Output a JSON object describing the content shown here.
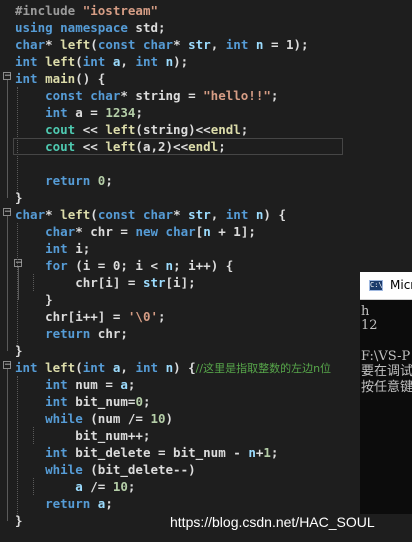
{
  "editor": {
    "lines": [
      [
        {
          "t": "#include ",
          "c": "pp"
        },
        {
          "t": "\"iostream\"",
          "c": "str"
        }
      ],
      [
        {
          "t": "using namespace ",
          "c": "kw"
        },
        {
          "t": "std;",
          "c": "var"
        }
      ],
      [
        {
          "t": "char",
          "c": "kw"
        },
        {
          "t": "* ",
          "c": "var"
        },
        {
          "t": "left",
          "c": "fn"
        },
        {
          "t": "(",
          "c": "var"
        },
        {
          "t": "const char",
          "c": "kw"
        },
        {
          "t": "* ",
          "c": "var"
        },
        {
          "t": "str",
          "c": "pm"
        },
        {
          "t": ", ",
          "c": "var"
        },
        {
          "t": "int ",
          "c": "kw"
        },
        {
          "t": "n",
          "c": "pm"
        },
        {
          "t": " = 1);",
          "c": "var"
        }
      ],
      [
        {
          "t": "int ",
          "c": "kw"
        },
        {
          "t": "left",
          "c": "fn"
        },
        {
          "t": "(",
          "c": "var"
        },
        {
          "t": "int ",
          "c": "kw"
        },
        {
          "t": "a",
          "c": "pm"
        },
        {
          "t": ", ",
          "c": "var"
        },
        {
          "t": "int ",
          "c": "kw"
        },
        {
          "t": "n",
          "c": "pm"
        },
        {
          "t": ");",
          "c": "var"
        }
      ],
      [
        {
          "t": "int ",
          "c": "kw"
        },
        {
          "t": "main",
          "c": "fn"
        },
        {
          "t": "() {",
          "c": "var"
        }
      ],
      [
        {
          "t": "    const char",
          "c": "kw"
        },
        {
          "t": "* string = ",
          "c": "var"
        },
        {
          "t": "\"hello!!\"",
          "c": "str"
        },
        {
          "t": ";",
          "c": "var"
        }
      ],
      [
        {
          "t": "    int ",
          "c": "kw"
        },
        {
          "t": "a = ",
          "c": "var"
        },
        {
          "t": "1234",
          "c": "num"
        },
        {
          "t": ";",
          "c": "var"
        }
      ],
      [
        {
          "t": "    cout ",
          "c": "ty"
        },
        {
          "t": "<< ",
          "c": "var"
        },
        {
          "t": "left",
          "c": "fn"
        },
        {
          "t": "(string)<<",
          "c": "var"
        },
        {
          "t": "endl",
          "c": "fn"
        },
        {
          "t": ";",
          "c": "var"
        }
      ],
      [
        {
          "t": "    cout ",
          "c": "ty"
        },
        {
          "t": "<< ",
          "c": "var"
        },
        {
          "t": "left",
          "c": "fn"
        },
        {
          "t": "(a,2)<<",
          "c": "var"
        },
        {
          "t": "endl",
          "c": "fn"
        },
        {
          "t": ";",
          "c": "var"
        }
      ],
      [],
      [
        {
          "t": "    return ",
          "c": "kw"
        },
        {
          "t": "0",
          "c": "num"
        },
        {
          "t": ";",
          "c": "var"
        }
      ],
      [
        {
          "t": "}",
          "c": "var"
        }
      ],
      [
        {
          "t": "char",
          "c": "kw"
        },
        {
          "t": "* ",
          "c": "var"
        },
        {
          "t": "left",
          "c": "fn"
        },
        {
          "t": "(",
          "c": "var"
        },
        {
          "t": "const char",
          "c": "kw"
        },
        {
          "t": "* ",
          "c": "var"
        },
        {
          "t": "str",
          "c": "pm"
        },
        {
          "t": ", ",
          "c": "var"
        },
        {
          "t": "int ",
          "c": "kw"
        },
        {
          "t": "n",
          "c": "pm"
        },
        {
          "t": ") {",
          "c": "var"
        }
      ],
      [
        {
          "t": "    char",
          "c": "kw"
        },
        {
          "t": "* chr = ",
          "c": "var"
        },
        {
          "t": "new char",
          "c": "kw"
        },
        {
          "t": "[",
          "c": "var"
        },
        {
          "t": "n",
          "c": "pm"
        },
        {
          "t": " + 1];",
          "c": "var"
        }
      ],
      [
        {
          "t": "    int ",
          "c": "kw"
        },
        {
          "t": "i;",
          "c": "var"
        }
      ],
      [
        {
          "t": "    for ",
          "c": "kw"
        },
        {
          "t": "(i = 0; i < ",
          "c": "var"
        },
        {
          "t": "n",
          "c": "pm"
        },
        {
          "t": "; i++) {",
          "c": "var"
        }
      ],
      [
        {
          "t": "        chr[i] = ",
          "c": "var"
        },
        {
          "t": "str",
          "c": "pm"
        },
        {
          "t": "[i];",
          "c": "var"
        }
      ],
      [
        {
          "t": "    }",
          "c": "var"
        }
      ],
      [
        {
          "t": "    chr[i++] = ",
          "c": "var"
        },
        {
          "t": "'\\0'",
          "c": "str"
        },
        {
          "t": ";",
          "c": "var"
        }
      ],
      [
        {
          "t": "    return ",
          "c": "kw"
        },
        {
          "t": "chr;",
          "c": "var"
        }
      ],
      [
        {
          "t": "}",
          "c": "var"
        }
      ],
      [
        {
          "t": "int ",
          "c": "kw"
        },
        {
          "t": "left",
          "c": "fn"
        },
        {
          "t": "(",
          "c": "var"
        },
        {
          "t": "int ",
          "c": "kw"
        },
        {
          "t": "a",
          "c": "pm"
        },
        {
          "t": ", ",
          "c": "var"
        },
        {
          "t": "int ",
          "c": "kw"
        },
        {
          "t": "n",
          "c": "pm"
        },
        {
          "t": ") {",
          "c": "var"
        },
        {
          "t": "//这里是指取整数的左边n位",
          "c": "cm"
        }
      ],
      [
        {
          "t": "    int ",
          "c": "kw"
        },
        {
          "t": "num = ",
          "c": "var"
        },
        {
          "t": "a",
          "c": "pm"
        },
        {
          "t": ";",
          "c": "var"
        }
      ],
      [
        {
          "t": "    int ",
          "c": "kw"
        },
        {
          "t": "bit_num=",
          "c": "var"
        },
        {
          "t": "0",
          "c": "num"
        },
        {
          "t": ";",
          "c": "var"
        }
      ],
      [
        {
          "t": "    while ",
          "c": "kw"
        },
        {
          "t": "(num /= ",
          "c": "var"
        },
        {
          "t": "10",
          "c": "num"
        },
        {
          "t": ")",
          "c": "var"
        }
      ],
      [
        {
          "t": "        bit_num++;",
          "c": "var"
        }
      ],
      [
        {
          "t": "    int ",
          "c": "kw"
        },
        {
          "t": "bit_delete = bit_num - ",
          "c": "var"
        },
        {
          "t": "n",
          "c": "pm"
        },
        {
          "t": "+",
          "c": "var"
        },
        {
          "t": "1",
          "c": "num"
        },
        {
          "t": ";",
          "c": "var"
        }
      ],
      [
        {
          "t": "    while ",
          "c": "kw"
        },
        {
          "t": "(bit_delete--)",
          "c": "var"
        }
      ],
      [
        {
          "t": "        a",
          "c": "pm"
        },
        {
          "t": " /= ",
          "c": "var"
        },
        {
          "t": "10",
          "c": "num"
        },
        {
          "t": ";",
          "c": "var"
        }
      ],
      [
        {
          "t": "    return ",
          "c": "kw"
        },
        {
          "t": "a",
          "c": "pm"
        },
        {
          "t": ";",
          "c": "var"
        }
      ],
      [
        {
          "t": "}",
          "c": "var"
        }
      ]
    ]
  },
  "console": {
    "title": "Micr",
    "icon_label": "C:\\",
    "lines": [
      "h",
      "12",
      "",
      "F:\\VS-P",
      "要在调试",
      "按任意键"
    ]
  },
  "watermark": "https://blog.csdn.net/HAC_SOUL"
}
